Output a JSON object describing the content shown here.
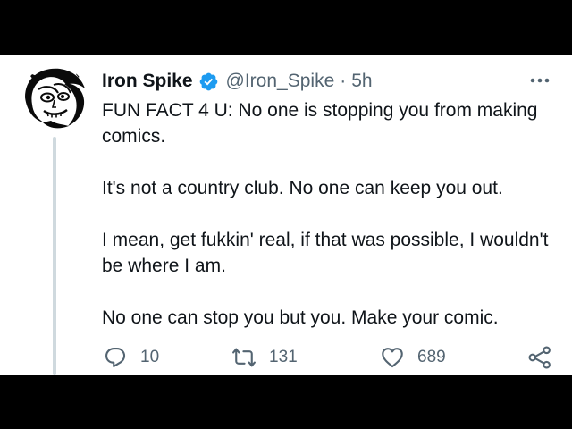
{
  "tweet": {
    "display_name": "Iron Spike",
    "handle": "@Iron_Spike",
    "separator": "·",
    "timestamp": "5h",
    "paragraphs": [
      "FUN FACT 4 U: No one is stopping you from making comics.",
      "It's not a country club. No one can keep you out.",
      "I mean, get fukkin' real, if that was possible, I wouldn't be where I am.",
      "No one can stop you but you. Make your comic."
    ],
    "actions": {
      "reply_count": "10",
      "retweet_count": "131",
      "like_count": "689"
    }
  },
  "icons": {
    "avatar": "avatar-illustration",
    "verified": "verified-badge-icon",
    "more": "more-options-icon",
    "reply": "reply-icon",
    "retweet": "retweet-icon",
    "like": "heart-icon",
    "share": "share-icon"
  },
  "colors": {
    "verified": "#1d9bf0",
    "text_primary": "#0f1419",
    "text_secondary": "#536471",
    "thread_line": "#cfd9de",
    "letterbox": "#000000"
  }
}
